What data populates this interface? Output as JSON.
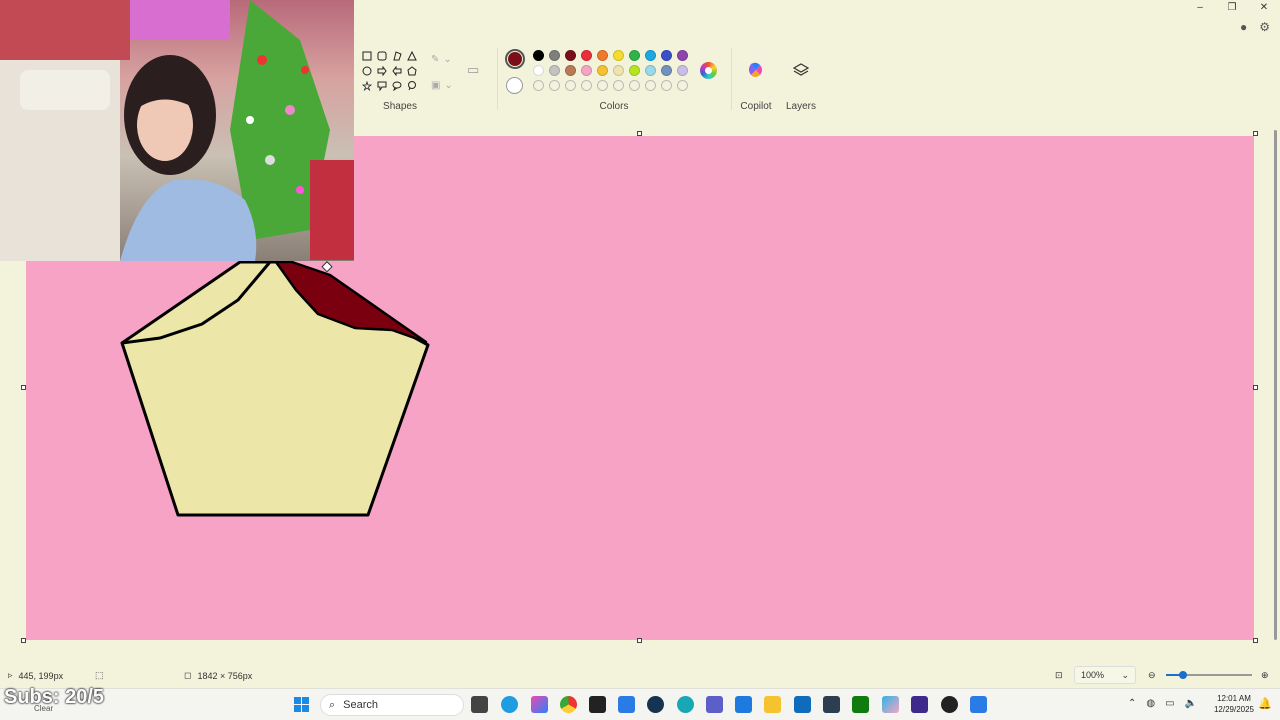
{
  "window": {
    "minimize": "–",
    "restore": "❐",
    "close": "✕"
  },
  "ribbon": {
    "shapes_label": "Shapes",
    "colors_label": "Colors",
    "copilot_label": "Copilot",
    "layers_label": "Layers",
    "shape_icons": [
      "rectangle-icon",
      "rounded-rectangle-icon",
      "polygon-icon",
      "triangle-icon",
      "oval-icon",
      "arrow-right-icon",
      "arrow-left-icon",
      "pentagon-icon",
      "star-icon",
      "callout-rect-icon",
      "callout-oval-icon",
      "callout-cloud-icon"
    ],
    "current_color": "#7a0f19",
    "secondary_color": "#ffffff",
    "palette_row1": [
      "#000000",
      "#7f7f7f",
      "#7a0f19",
      "#e8303a",
      "#f07a2b",
      "#f5dc2e",
      "#2fb34a",
      "#1ea7e1",
      "#3a4fc8",
      "#8e44ad"
    ],
    "palette_row2": [
      "#ffffff",
      "#c3c3c3",
      "#b97a57",
      "#f5a5c4",
      "#f5c330",
      "#efe4b0",
      "#b5e61d",
      "#99d9ea",
      "#7092be",
      "#c8bfe7"
    ]
  },
  "status": {
    "cursor_pos": "445, 199px",
    "canvas_size": "1842 × 756px",
    "zoom": "100%",
    "zoom_level": 0.2
  },
  "taskbar": {
    "search_placeholder": "Search",
    "time": "12:01 AM",
    "date": "12/29/2025"
  },
  "overlay": {
    "subs": "Subs: 20/5",
    "clear_label": "Clear"
  }
}
